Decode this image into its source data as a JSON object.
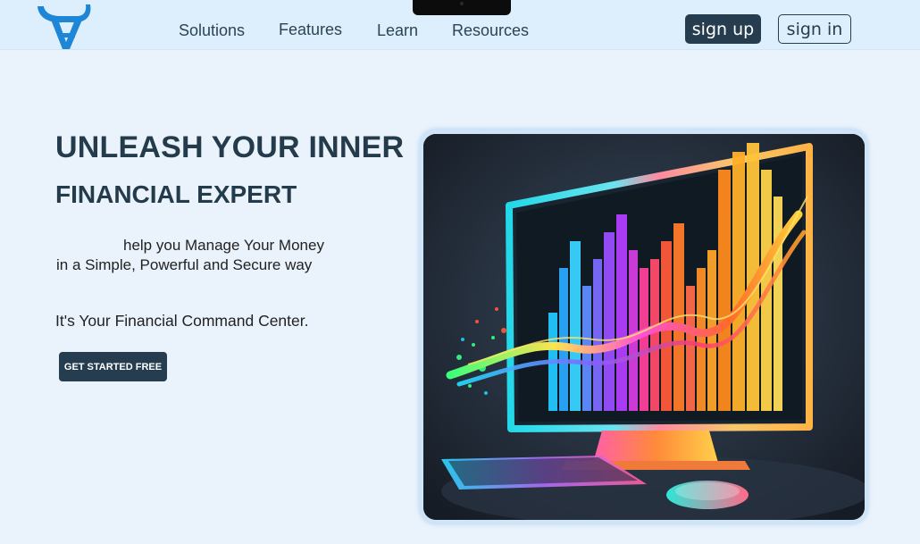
{
  "nav": {
    "links": [
      {
        "label": "Solutions"
      },
      {
        "label": "Features"
      },
      {
        "label": "Learn"
      },
      {
        "label": "Resources"
      }
    ],
    "signup_label": "sign up",
    "signin_label": "sign in",
    "logo_icon": "bull-horns-logo-icon"
  },
  "hero": {
    "title_line1": "UNLEASH YOUR INNER",
    "title_line2": "FINANCIAL EXPERT",
    "description_line1": "help you Manage Your Money",
    "description_line2": "in a Simple, Powerful and Secure way",
    "tagline": "It's Your Financial Command Center.",
    "cta_label": "GET STARTED FREE",
    "image_icon": "computer-chart-illustration"
  },
  "colors": {
    "primary": "#253d4e",
    "background": "#eaf3fc",
    "navbar": "#ddeefc",
    "logo_blue": "#1e86d6"
  }
}
